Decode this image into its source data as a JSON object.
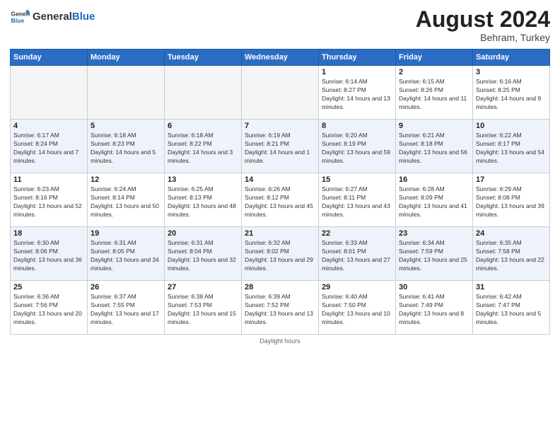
{
  "header": {
    "logo_general": "General",
    "logo_blue": "Blue",
    "month_year": "August 2024",
    "location": "Behram, Turkey"
  },
  "weekdays": [
    "Sunday",
    "Monday",
    "Tuesday",
    "Wednesday",
    "Thursday",
    "Friday",
    "Saturday"
  ],
  "weeks": [
    [
      {
        "day": "",
        "info": ""
      },
      {
        "day": "",
        "info": ""
      },
      {
        "day": "",
        "info": ""
      },
      {
        "day": "",
        "info": ""
      },
      {
        "day": "1",
        "info": "Sunrise: 6:14 AM\nSunset: 8:27 PM\nDaylight: 14 hours and 13 minutes."
      },
      {
        "day": "2",
        "info": "Sunrise: 6:15 AM\nSunset: 8:26 PM\nDaylight: 14 hours and 11 minutes."
      },
      {
        "day": "3",
        "info": "Sunrise: 6:16 AM\nSunset: 8:25 PM\nDaylight: 14 hours and 9 minutes."
      }
    ],
    [
      {
        "day": "4",
        "info": "Sunrise: 6:17 AM\nSunset: 8:24 PM\nDaylight: 14 hours and 7 minutes."
      },
      {
        "day": "5",
        "info": "Sunrise: 6:18 AM\nSunset: 8:23 PM\nDaylight: 14 hours and 5 minutes."
      },
      {
        "day": "6",
        "info": "Sunrise: 6:18 AM\nSunset: 8:22 PM\nDaylight: 14 hours and 3 minutes."
      },
      {
        "day": "7",
        "info": "Sunrise: 6:19 AM\nSunset: 8:21 PM\nDaylight: 14 hours and 1 minute."
      },
      {
        "day": "8",
        "info": "Sunrise: 6:20 AM\nSunset: 8:19 PM\nDaylight: 13 hours and 59 minutes."
      },
      {
        "day": "9",
        "info": "Sunrise: 6:21 AM\nSunset: 8:18 PM\nDaylight: 13 hours and 56 minutes."
      },
      {
        "day": "10",
        "info": "Sunrise: 6:22 AM\nSunset: 8:17 PM\nDaylight: 13 hours and 54 minutes."
      }
    ],
    [
      {
        "day": "11",
        "info": "Sunrise: 6:23 AM\nSunset: 8:16 PM\nDaylight: 13 hours and 52 minutes."
      },
      {
        "day": "12",
        "info": "Sunrise: 6:24 AM\nSunset: 8:14 PM\nDaylight: 13 hours and 50 minutes."
      },
      {
        "day": "13",
        "info": "Sunrise: 6:25 AM\nSunset: 8:13 PM\nDaylight: 13 hours and 48 minutes."
      },
      {
        "day": "14",
        "info": "Sunrise: 6:26 AM\nSunset: 8:12 PM\nDaylight: 13 hours and 45 minutes."
      },
      {
        "day": "15",
        "info": "Sunrise: 6:27 AM\nSunset: 8:11 PM\nDaylight: 13 hours and 43 minutes."
      },
      {
        "day": "16",
        "info": "Sunrise: 6:28 AM\nSunset: 8:09 PM\nDaylight: 13 hours and 41 minutes."
      },
      {
        "day": "17",
        "info": "Sunrise: 6:29 AM\nSunset: 8:08 PM\nDaylight: 13 hours and 39 minutes."
      }
    ],
    [
      {
        "day": "18",
        "info": "Sunrise: 6:30 AM\nSunset: 8:06 PM\nDaylight: 13 hours and 36 minutes."
      },
      {
        "day": "19",
        "info": "Sunrise: 6:31 AM\nSunset: 8:05 PM\nDaylight: 13 hours and 34 minutes."
      },
      {
        "day": "20",
        "info": "Sunrise: 6:31 AM\nSunset: 8:04 PM\nDaylight: 13 hours and 32 minutes."
      },
      {
        "day": "21",
        "info": "Sunrise: 6:32 AM\nSunset: 8:02 PM\nDaylight: 13 hours and 29 minutes."
      },
      {
        "day": "22",
        "info": "Sunrise: 6:33 AM\nSunset: 8:01 PM\nDaylight: 13 hours and 27 minutes."
      },
      {
        "day": "23",
        "info": "Sunrise: 6:34 AM\nSunset: 7:59 PM\nDaylight: 13 hours and 25 minutes."
      },
      {
        "day": "24",
        "info": "Sunrise: 6:35 AM\nSunset: 7:58 PM\nDaylight: 13 hours and 22 minutes."
      }
    ],
    [
      {
        "day": "25",
        "info": "Sunrise: 6:36 AM\nSunset: 7:56 PM\nDaylight: 13 hours and 20 minutes."
      },
      {
        "day": "26",
        "info": "Sunrise: 6:37 AM\nSunset: 7:55 PM\nDaylight: 13 hours and 17 minutes."
      },
      {
        "day": "27",
        "info": "Sunrise: 6:38 AM\nSunset: 7:53 PM\nDaylight: 13 hours and 15 minutes."
      },
      {
        "day": "28",
        "info": "Sunrise: 6:39 AM\nSunset: 7:52 PM\nDaylight: 13 hours and 13 minutes."
      },
      {
        "day": "29",
        "info": "Sunrise: 6:40 AM\nSunset: 7:50 PM\nDaylight: 13 hours and 10 minutes."
      },
      {
        "day": "30",
        "info": "Sunrise: 6:41 AM\nSunset: 7:49 PM\nDaylight: 13 hours and 8 minutes."
      },
      {
        "day": "31",
        "info": "Sunrise: 6:42 AM\nSunset: 7:47 PM\nDaylight: 13 hours and 5 minutes."
      }
    ]
  ],
  "footer": "Daylight hours"
}
